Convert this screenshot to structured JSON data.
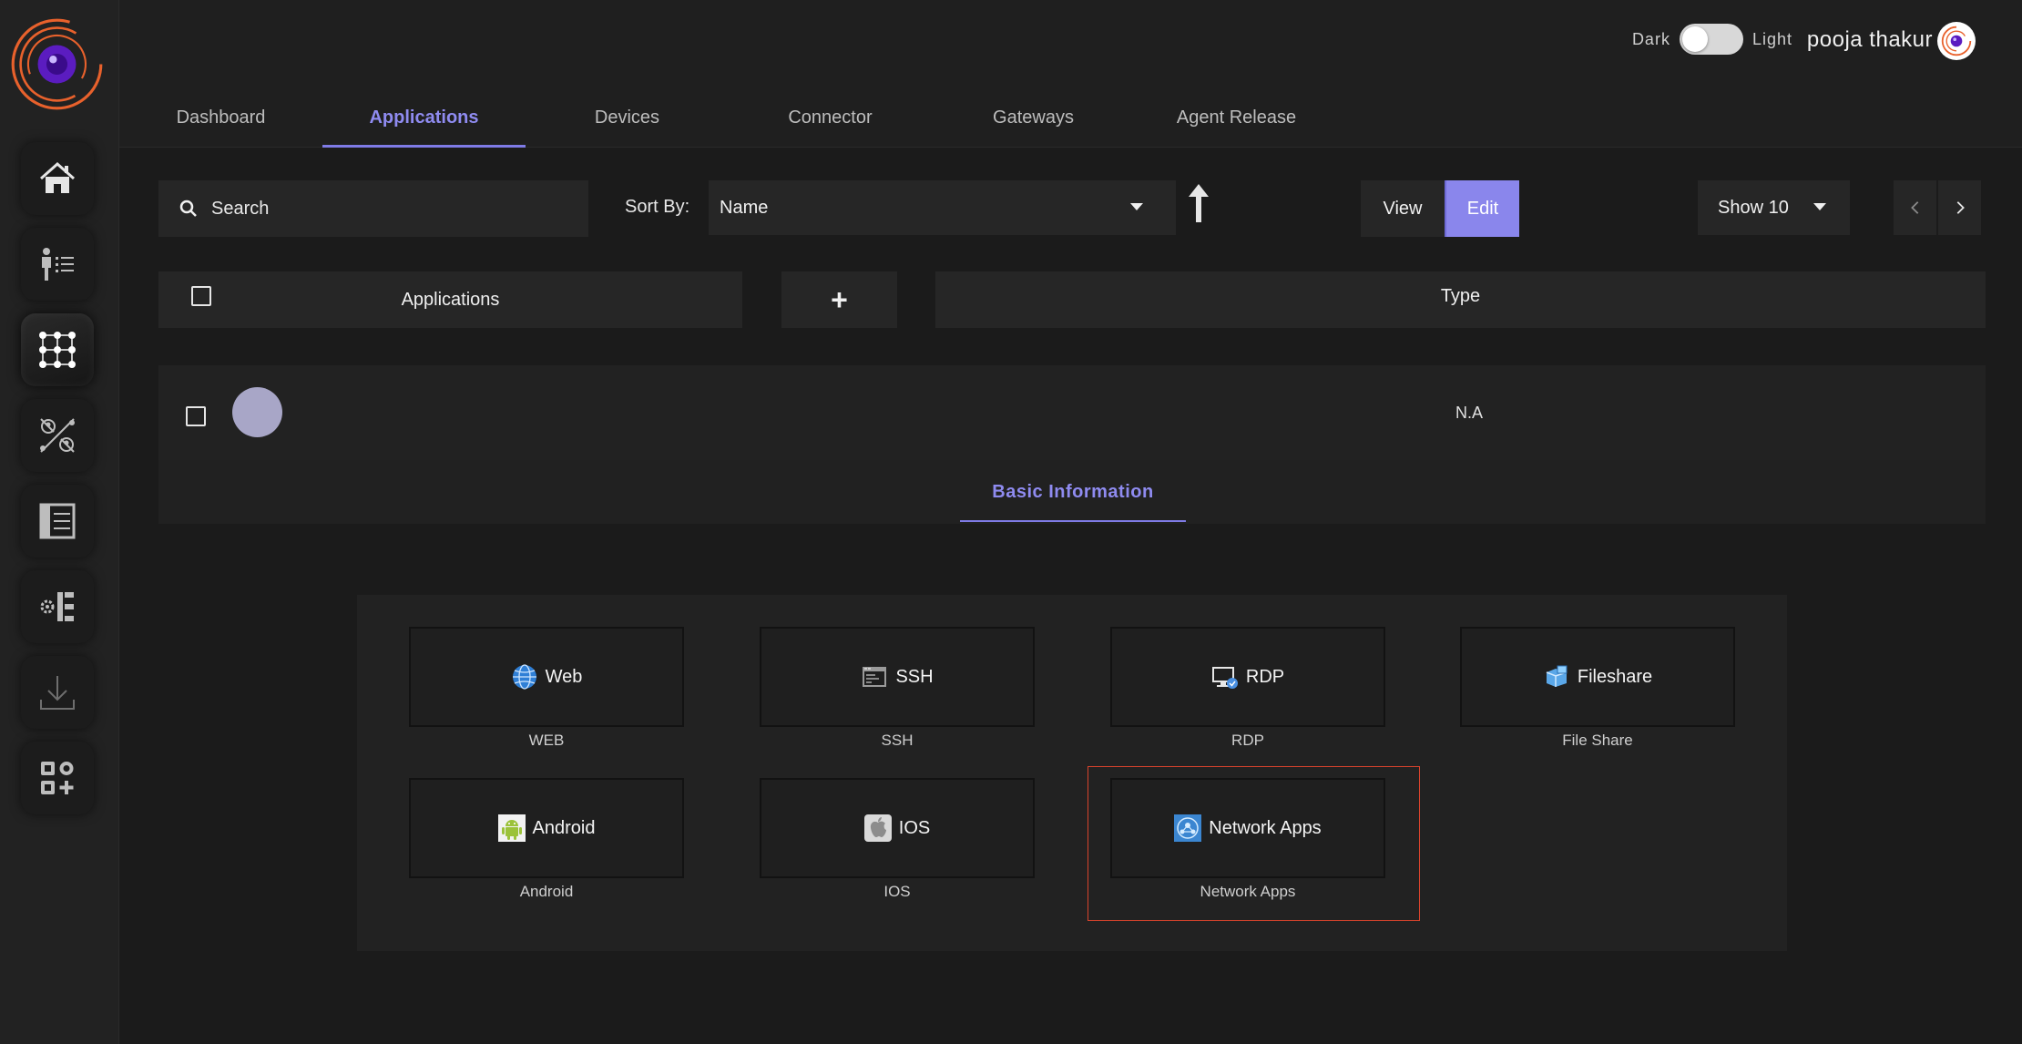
{
  "header": {
    "theme_dark_label": "Dark",
    "theme_light_label": "Light",
    "user_name": "pooja thakur"
  },
  "tabs": [
    {
      "label": "Dashboard",
      "active": false
    },
    {
      "label": "Applications",
      "active": true
    },
    {
      "label": "Devices",
      "active": false
    },
    {
      "label": "Connector",
      "active": false
    },
    {
      "label": "Gateways",
      "active": false
    },
    {
      "label": "Agent Release",
      "active": false
    }
  ],
  "sidebar": {
    "items": [
      {
        "icon": "home-icon"
      },
      {
        "icon": "user-list-icon"
      },
      {
        "icon": "grid-network-icon",
        "active": true
      },
      {
        "icon": "people-connect-icon"
      },
      {
        "icon": "table-layout-icon"
      },
      {
        "icon": "settings-list-icon"
      },
      {
        "icon": "download-icon"
      },
      {
        "icon": "apps-add-icon"
      }
    ]
  },
  "toolbar": {
    "search_placeholder": "Search",
    "sort_label": "Sort By:",
    "sort_value": "Name",
    "view_label": "View",
    "edit_label": "Edit",
    "show_value": "Show 10"
  },
  "table": {
    "col_applications": "Applications",
    "add_symbol": "+",
    "col_type": "Type",
    "rows": [
      {
        "type": "N.A"
      }
    ]
  },
  "detail": {
    "tab_label": "Basic Information"
  },
  "app_types": [
    {
      "label": "Web",
      "caption": "WEB",
      "icon": "globe-icon"
    },
    {
      "label": "SSH",
      "caption": "SSH",
      "icon": "terminal-icon"
    },
    {
      "label": "RDP",
      "caption": "RDP",
      "icon": "remote-desktop-icon"
    },
    {
      "label": "Fileshare",
      "caption": "File Share",
      "icon": "fileshare-icon"
    },
    {
      "label": "Android",
      "caption": "Android",
      "icon": "android-icon"
    },
    {
      "label": "IOS",
      "caption": "IOS",
      "icon": "apple-icon"
    },
    {
      "label": "Network Apps",
      "caption": "Network Apps",
      "icon": "network-apps-icon",
      "highlighted": true
    }
  ],
  "colors": {
    "accent": "#8a86ec",
    "highlight_border": "#d8432c",
    "logo_orange": "#e8612c",
    "logo_purple": "#6a1fc4"
  }
}
